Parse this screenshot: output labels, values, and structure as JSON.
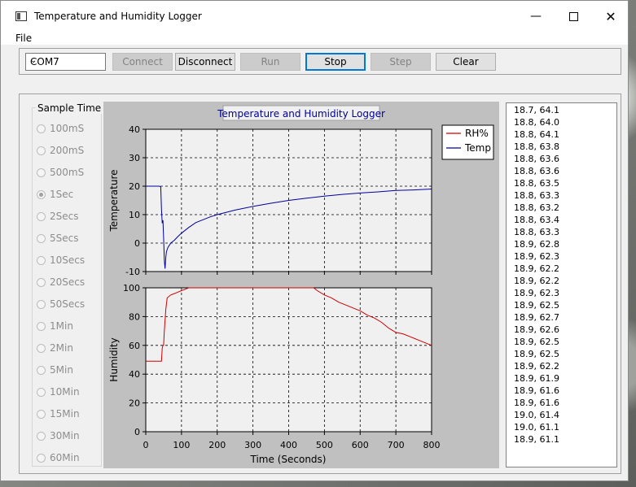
{
  "window": {
    "title": "Temperature and Humidity Logger",
    "controls": [
      "minimize-icon",
      "maximize-icon",
      "close-icon"
    ]
  },
  "menu": {
    "items": [
      "File"
    ]
  },
  "toolbar": {
    "port": "COM7",
    "buttons": [
      {
        "label": "Connect",
        "enabled": false
      },
      {
        "label": "Disconnect",
        "enabled": true
      },
      {
        "label": "Run",
        "enabled": false
      },
      {
        "label": "Stop",
        "enabled": true,
        "focused": true
      },
      {
        "label": "Step",
        "enabled": false
      },
      {
        "label": "Clear",
        "enabled": true
      }
    ]
  },
  "sample_time": {
    "title": "Sample Time",
    "selected": "1Sec",
    "options": [
      "100mS",
      "200mS",
      "500mS",
      "1Sec",
      "2Secs",
      "5Secs",
      "10Secs",
      "20Secs",
      "50Secs",
      "1Min",
      "2Min",
      "5Min",
      "10Min",
      "15Min",
      "30Min",
      "60Min"
    ]
  },
  "chart_data": {
    "type": "line",
    "title": "Temperature and Humidity Logger",
    "xlabel": "Time (Seconds)",
    "xlim": [
      0,
      800
    ],
    "xticks": [
      0,
      100,
      200,
      300,
      400,
      500,
      600,
      700,
      800
    ],
    "grid": true,
    "legend_placement": "top-right",
    "legend": [
      "RH%",
      "Temp"
    ],
    "colors": {
      "rh": "#cc0000",
      "temp": "#000099",
      "plot_bg": "#f0f0f0",
      "frame_bg": "#c0c0c0"
    },
    "panels": [
      {
        "ylabel": "Temperature",
        "ylim": [
          -10,
          40
        ],
        "yticks": [
          -10,
          0,
          10,
          20,
          30,
          40
        ],
        "series": [
          {
            "name": "Temp",
            "color": "#000099",
            "points": [
              [
                0,
                20
              ],
              [
                20,
                20
              ],
              [
                30,
                20
              ],
              [
                38,
                20
              ],
              [
                42,
                19.8
              ],
              [
                44,
                12
              ],
              [
                46,
                7
              ],
              [
                48,
                8
              ],
              [
                50,
                2
              ],
              [
                52,
                -6
              ],
              [
                54,
                -9
              ],
              [
                56,
                -5
              ],
              [
                58,
                -3
              ],
              [
                62,
                -1.5
              ],
              [
                70,
                0
              ],
              [
                80,
                1
              ],
              [
                90,
                2.3
              ],
              [
                100,
                3.5
              ],
              [
                120,
                5.5
              ],
              [
                140,
                7.2
              ],
              [
                160,
                8.2
              ],
              [
                180,
                9.2
              ],
              [
                200,
                10
              ],
              [
                250,
                11.6
              ],
              [
                300,
                12.9
              ],
              [
                350,
                14
              ],
              [
                400,
                15
              ],
              [
                450,
                15.8
              ],
              [
                500,
                16.5
              ],
              [
                550,
                17.1
              ],
              [
                600,
                17.6
              ],
              [
                650,
                18
              ],
              [
                700,
                18.5
              ],
              [
                750,
                18.7
              ],
              [
                800,
                19
              ]
            ]
          }
        ]
      },
      {
        "ylabel": "Humidity",
        "ylim": [
          0,
          100
        ],
        "yticks": [
          0,
          20,
          40,
          60,
          80,
          100
        ],
        "series": [
          {
            "name": "RH%",
            "color": "#cc0000",
            "points": [
              [
                0,
                49
              ],
              [
                40,
                49
              ],
              [
                44,
                49
              ],
              [
                46,
                58
              ],
              [
                48,
                60
              ],
              [
                50,
                60
              ],
              [
                52,
                70
              ],
              [
                56,
                85
              ],
              [
                60,
                93
              ],
              [
                70,
                95
              ],
              [
                80,
                96
              ],
              [
                90,
                97
              ],
              [
                100,
                98
              ],
              [
                110,
                99
              ],
              [
                120,
                100
              ],
              [
                200,
                100
              ],
              [
                300,
                100
              ],
              [
                400,
                100
              ],
              [
                470,
                100
              ],
              [
                480,
                98
              ],
              [
                500,
                95
              ],
              [
                520,
                93
              ],
              [
                540,
                90
              ],
              [
                560,
                88
              ],
              [
                580,
                86
              ],
              [
                600,
                84
              ],
              [
                620,
                81
              ],
              [
                640,
                79
              ],
              [
                660,
                76
              ],
              [
                680,
                72
              ],
              [
                700,
                69
              ],
              [
                720,
                68
              ],
              [
                740,
                66
              ],
              [
                760,
                64
              ],
              [
                780,
                62
              ],
              [
                800,
                60
              ]
            ]
          }
        ]
      }
    ]
  },
  "log": {
    "entries": [
      "18.7, 64.1",
      "18.8, 64.0",
      "18.8, 64.1",
      "18.8, 63.8",
      "18.8, 63.6",
      "18.8, 63.6",
      "18.8, 63.5",
      "18.8, 63.3",
      "18.8, 63.2",
      "18.8, 63.4",
      "18.8, 63.3",
      "18.9, 62.8",
      "18.9, 62.3",
      "18.9, 62.2",
      "18.9, 62.2",
      "18.9, 62.3",
      "18.9, 62.5",
      "18.9, 62.7",
      "18.9, 62.6",
      "18.9, 62.5",
      "18.9, 62.5",
      "18.9, 62.2",
      "18.9, 61.9",
      "18.9, 61.6",
      "18.9, 61.6",
      "19.0, 61.4",
      "19.0, 61.1",
      "18.9, 61.1"
    ]
  }
}
